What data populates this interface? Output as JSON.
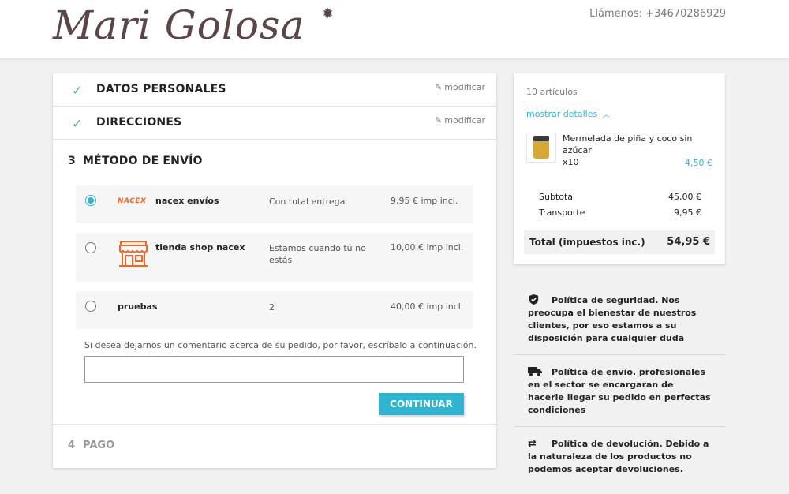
{
  "header": {
    "logo": "Mari Golosa",
    "phone": "Llámenos: +34670286929"
  },
  "steps": {
    "personal": {
      "title": "DATOS PERSONALES",
      "modify": "modificar"
    },
    "addresses": {
      "title": "DIRECCIONES",
      "modify": "modificar"
    },
    "shipping": {
      "number": "3",
      "title": "MÉTODO DE ENVÍO",
      "options": [
        {
          "carrier": "nacex envíos",
          "delay": "Con total entrega",
          "price": "9,95 € imp incl.",
          "selected": true,
          "logo_text": "NACEX"
        },
        {
          "carrier": "tienda shop nacex",
          "delay": "Estamos cuando tú no estás",
          "price": "10,00 € imp incl.",
          "selected": false
        },
        {
          "carrier": "pruebas",
          "delay": "2",
          "price": "40,00 € imp incl.",
          "selected": false
        }
      ],
      "comment_label": "Si desea dejarnos un comentario acerca de su pedido, por favor, escríbalo a continuación.",
      "continue_label": "CONTINUAR"
    },
    "payment": {
      "number": "4",
      "title": "PAGO"
    }
  },
  "cart": {
    "items_count": "10 artículos",
    "show_details": "mostrar detalles",
    "product": {
      "name": "Mermelada de piña y coco sin azúcar",
      "qty": "x10",
      "price": "4,50 €"
    },
    "subtotal_label": "Subtotal",
    "subtotal_value": "45,00 €",
    "shipping_label": "Transporte",
    "shipping_value": "9,95 €",
    "total_label": "Total (impuestos inc.)",
    "total_value": "54,95 €"
  },
  "reassurance": [
    {
      "icon": "shield-check-icon",
      "text": "Política de seguridad. Nos preocupa el bienestar de nuestros clientes, por eso estamos a su disposición para cualquier duda"
    },
    {
      "icon": "truck-icon",
      "text": "Política de envío. profesionales en el sector se encargaran de hacerle llegar su pedido en perfectas condiciones"
    },
    {
      "icon": "swap-arrows-icon",
      "text": "Política de devolución. Debido a la naturaleza de los productos no podemos aceptar devoluciones."
    }
  ],
  "colors": {
    "accent": "#2fb5d2",
    "check": "#4cbb6c",
    "nacex": "#f26522",
    "logo": "#5a4646"
  }
}
